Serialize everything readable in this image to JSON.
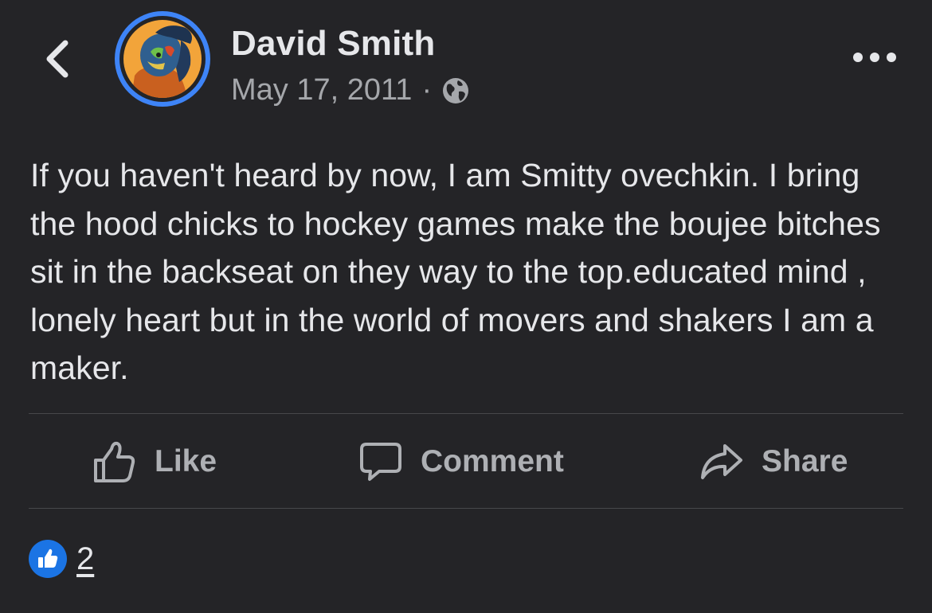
{
  "header": {
    "back_icon": "chevron-left-icon",
    "author_name": "David Smith",
    "date": "May 17, 2011",
    "separator": "·",
    "privacy_icon": "globe-icon",
    "more_icon": "more-horizontal-icon"
  },
  "post": {
    "text": "If you haven't heard by now, I am Smitty ovechkin. I bring the hood chicks to hockey games make the boujee bitches sit in the backseat on they way to the top.educated mind , lonely heart but in the world of movers and shakers I am a maker."
  },
  "actions": {
    "like_label": "Like",
    "comment_label": "Comment",
    "share_label": "Share"
  },
  "reactions": {
    "icon": "like-reaction-icon",
    "count": "2"
  },
  "colors": {
    "background": "#242427",
    "primary_text": "#e6e7ea",
    "secondary_text": "#a5a7ab",
    "action_text": "#aeb0b4",
    "avatar_ring": "#3e84f7",
    "like_blue": "#1b74e4",
    "divider": "#47484b"
  }
}
